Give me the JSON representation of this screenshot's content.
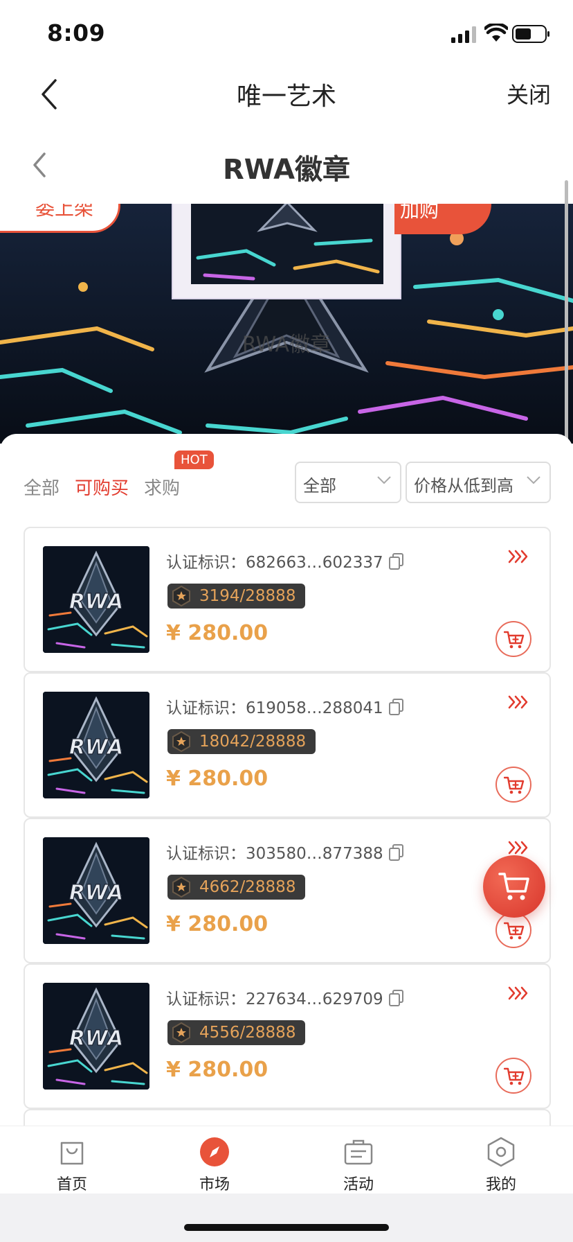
{
  "status_bar": {
    "time": "8:09"
  },
  "app_nav": {
    "title": "唯一艺术",
    "close_label": "关闭"
  },
  "page_nav": {
    "title": "RWA徽章"
  },
  "banner": {
    "left_pill_text": "委上架",
    "right_pill_text": "加购",
    "watermark_text": "RWA徽章"
  },
  "filters": {
    "tabs": [
      {
        "label": "全部",
        "active": false
      },
      {
        "label": "可购买",
        "active": true
      },
      {
        "label": "求购",
        "active": false
      }
    ],
    "hot_badge": "HOT",
    "category_select": "全部",
    "sort_select": "价格从低到高"
  },
  "listings": [
    {
      "cert_label": "认证标识：",
      "cert_id": "682663…602337",
      "edition": "3194/28888",
      "price": "¥ 280.00"
    },
    {
      "cert_label": "认证标识：",
      "cert_id": "619058…288041",
      "edition": "18042/28888",
      "price": "¥ 280.00"
    },
    {
      "cert_label": "认证标识：",
      "cert_id": "303580…877388",
      "edition": "4662/28888",
      "price": "¥ 280.00"
    },
    {
      "cert_label": "认证标识：",
      "cert_id": "227634…629709",
      "edition": "4556/28888",
      "price": "¥ 280.00"
    }
  ],
  "thumbnail_text": "RWA",
  "tabbar": {
    "items": [
      {
        "label": "首页",
        "icon": "bag-icon",
        "active": false
      },
      {
        "label": "市场",
        "icon": "compass-icon",
        "active": true
      },
      {
        "label": "活动",
        "icon": "briefcase-icon",
        "active": false
      },
      {
        "label": "我的",
        "icon": "hexagon-user-icon",
        "active": false
      }
    ]
  },
  "colors": {
    "accent": "#e23b2e",
    "price": "#e9a14a",
    "edition_bg": "#3a3a3a"
  }
}
